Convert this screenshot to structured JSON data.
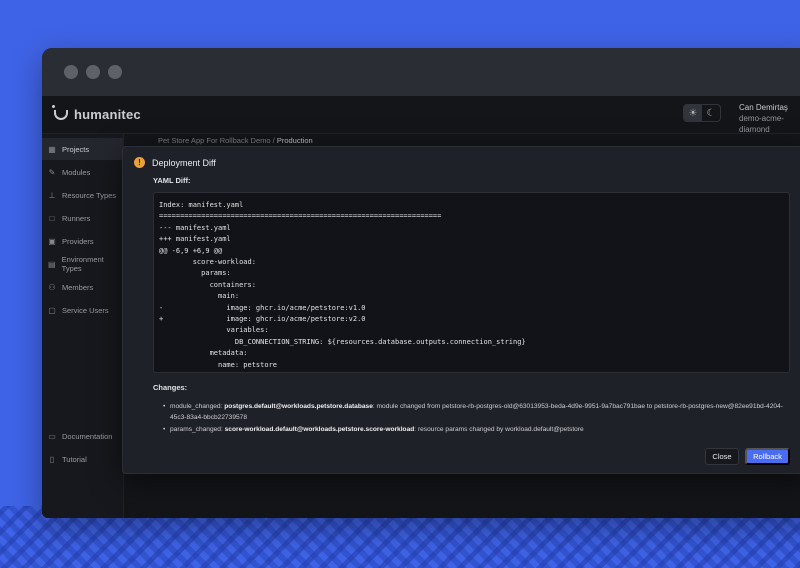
{
  "app": {
    "brand": "humanitec",
    "user_name": "Can Demirtaş",
    "user_org": "demo-acme-diamond",
    "theme_light_icon": "sun-icon",
    "theme_dark_icon": "moon-icon"
  },
  "sidebar": {
    "items": [
      {
        "label": "Projects",
        "icon": "grid-icon"
      },
      {
        "label": "Modules",
        "icon": "puzzle-icon"
      },
      {
        "label": "Resource Types",
        "icon": "hierarchy-icon"
      },
      {
        "label": "Runners",
        "icon": "runner-icon"
      },
      {
        "label": "Providers",
        "icon": "provider-icon"
      },
      {
        "label": "Environment Types",
        "icon": "environment-icon"
      },
      {
        "label": "Members",
        "icon": "members-icon"
      },
      {
        "label": "Service Users",
        "icon": "service-user-icon"
      }
    ],
    "bottom_items": [
      {
        "label": "Documentation",
        "icon": "document-icon"
      },
      {
        "label": "Tutorial",
        "icon": "book-icon"
      }
    ]
  },
  "breadcrumb": {
    "app": "Pet Store App For Rollback Demo",
    "separator": "/",
    "env": "Production"
  },
  "modal": {
    "title": "Deployment Diff",
    "subtitle": "YAML Diff:",
    "diff": "Index: manifest.yaml\n===================================================================\n--- manifest.yaml\n+++ manifest.yaml\n@@ -6,9 +6,9 @@\n        score-workload:\n          params:\n            containers:\n              main:\n-               image: ghcr.io/acme/petstore:v1.0\n+               image: ghcr.io/acme/petstore:v2.0\n                variables:\n                  DB_CONNECTION_STRING: ${resources.database.outputs.connection_string}\n            metadata:\n              name: petstore",
    "changes_label": "Changes:",
    "changes": [
      {
        "key": "module_changed:",
        "target": "postgres.default@workloads.petstore.database",
        "text": ": module changed from petstore-rb-postgres-old@63013953-beda-4d9e-9951-9a7bac791bae to petstore-rb-postgres-new@82ee91bd-4204-45c3-83a4-bbcb22739578"
      },
      {
        "key": "params_changed:",
        "target": "score-workload.default@workloads.petstore.score-workload",
        "text": ": resource params changed by workload.default@petstore"
      }
    ],
    "close_label": "Close",
    "rollback_label": "Rollback",
    "accent": "#4a6cf0",
    "warning_color": "#e9a23b"
  }
}
